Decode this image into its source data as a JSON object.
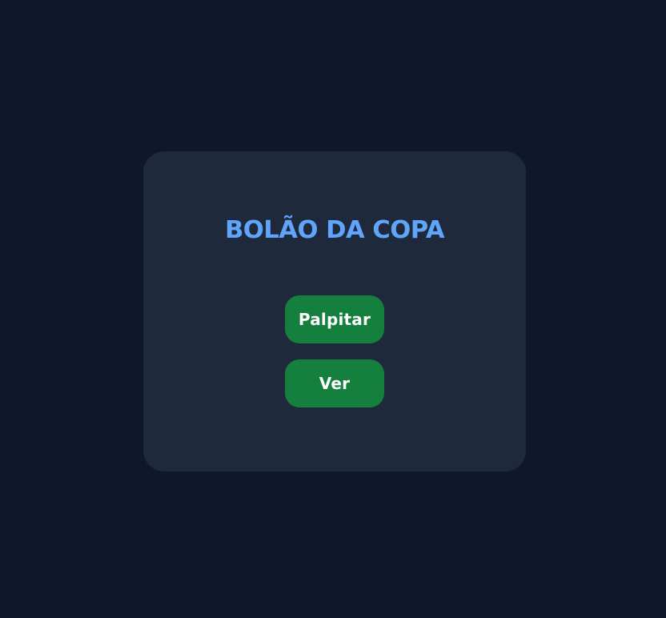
{
  "app": {
    "title": "BOLÃO DA COPA"
  },
  "actions": {
    "palpitar_label": "Palpitar",
    "ver_label": "Ver"
  },
  "colors": {
    "background": "#0f172a",
    "card": "#1e293b",
    "title": "#60a5fa",
    "button": "#15803d",
    "button_text": "#ffffff"
  }
}
